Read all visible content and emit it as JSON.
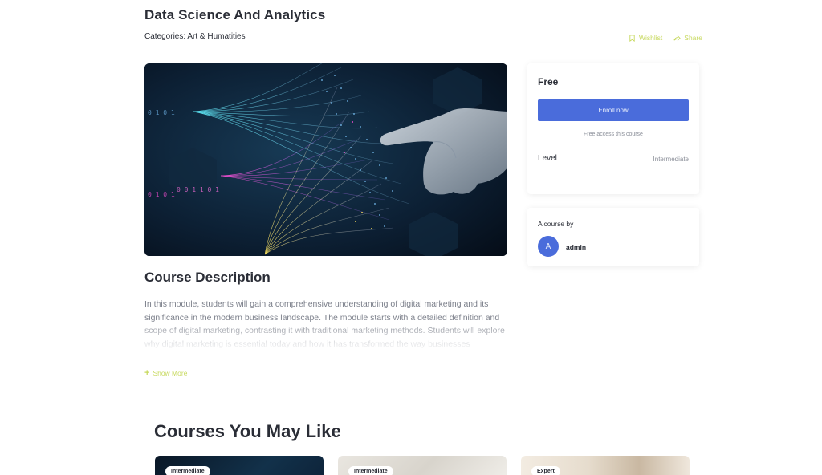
{
  "course": {
    "title": "Data Science And Analytics",
    "categories_label": "Categories:",
    "category": "Art & Humatities"
  },
  "actions": {
    "wishlist": "Wishlist",
    "share": "Share",
    "accent_color": "#c7d95e"
  },
  "hero": {
    "icon": "data-science-hero-image"
  },
  "description": {
    "heading": "Course Description",
    "text": "In this module, students will gain a comprehensive understanding of digital marketing and its significance in the modern business landscape. The module starts with a detailed definition and scope of digital marketing, contrasting it with traditional marketing methods. Students will explore why digital marketing is essential today and how it has transformed the way businesses",
    "show_more": "Show More"
  },
  "pricing": {
    "price": "Free",
    "enroll_label": "Enroll now",
    "free_access": "Free access this course",
    "level_label": "Level",
    "level_value": "Intermediate",
    "button_color": "#4a6cdb"
  },
  "author": {
    "label": "A course by",
    "initial": "A",
    "name": "admin"
  },
  "related": {
    "heading": "Courses You May Like",
    "cards": [
      {
        "badge": "Intermediate"
      },
      {
        "badge": "Intermediate"
      },
      {
        "badge": "Expert"
      }
    ]
  }
}
